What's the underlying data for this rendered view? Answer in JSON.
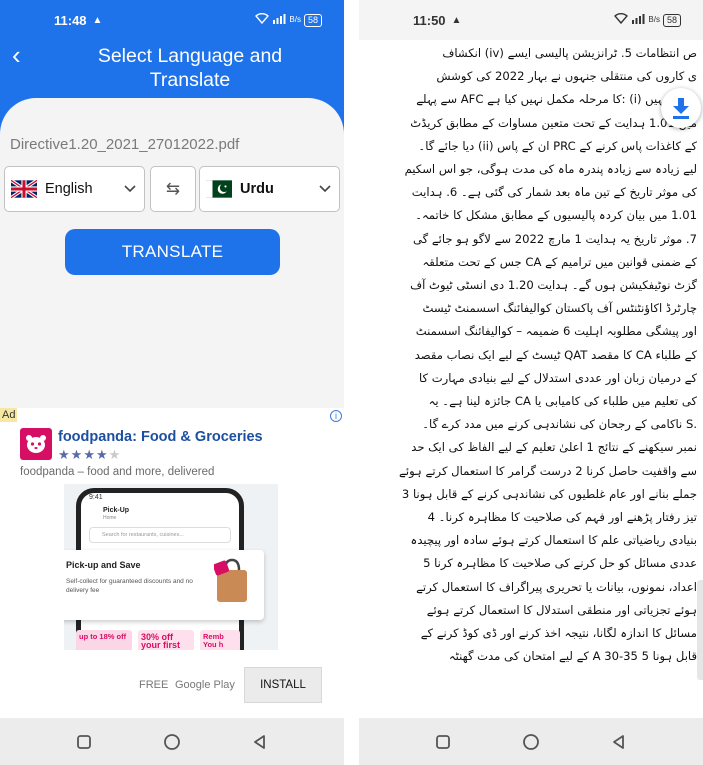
{
  "left_screen": {
    "status": {
      "time": "11:48",
      "signal_label": "B/s",
      "battery": "58"
    },
    "header": {
      "title": "Select Language and Translate"
    },
    "file_name": "Directive1.20_2021_27012022.pdf",
    "source_language": {
      "label": "English",
      "flag_icon": "uk-flag-icon"
    },
    "target_language": {
      "label": "Urdu",
      "flag_icon": "pakistan-flag-icon"
    },
    "translate_label": "TRANSLATE",
    "ad": {
      "badge": "Ad",
      "info_glyph": "i",
      "title": "foodpanda: Food & Groceries",
      "rating": 4,
      "description": "foodpanda – food and more, delivered",
      "mockup": {
        "time": "9:41",
        "screen_title": "Pick-Up",
        "screen_subtitle": "Home",
        "search_placeholder": "Search for restaurants, cuisines...",
        "card_title": "Pick-up and Save",
        "card_desc": "Self-collect for guaranteed discounts and no delivery fee",
        "promos": [
          "up to 18% off",
          "30% off your first",
          "Remb You h"
        ]
      },
      "price": "FREE",
      "store": "Google Play",
      "install_label": "INSTALL"
    }
  },
  "right_screen": {
    "status": {
      "time": "11:50",
      "signal_label": "B/s",
      "battery": "58"
    },
    "document_lines": [
      "ص انتظامات 5. ٹرانزیشن پالیسی ایسے (iv) انکشاف",
      "ی کاروں کی منتقلی جنہوں نے بہار 2022 کی کوشش",
      "PRC انہیں (i) :کا مرحلہ مکمل نہیں کیا ہے AFC سے پہلے",
      "میں 1.01 ہدایت کے تحت متعین مساوات کے مطابق کریڈٹ",
      "کے کاغذات پاس کرنے کے PRC ان کے پاس (ii) دیا جائے گا۔",
      "لیے زیادہ سے زیادہ پندرہ ماہ کی مدت ہوگی، جو اس اسکیم",
      "کی موثر تاریخ کے تین ماہ بعد شمار کی گئی ہے۔ 6. ہدایت",
      "1.01 میں بیان کردہ پالیسیوں کے مطابق مشکل کا خاتمہ۔",
      "7. موثر تاریخ یہ ہدایت 1 مارچ 2022 سے لاگو ہو جائے گی",
      "کے ضمنی قوانین میں ترامیم کے CA جس کے تحت متعلقہ",
      "گزٹ نوٹیفکیشن ہوں گے۔ ہدایت 1.20 دی انسٹی ٹیوٹ آف",
      "چارٹرڈ اکاؤنٹنٹس آف پاکستان کوالیفائنگ اسسمنٹ ٹیسٹ",
      "اور پیشگی مطلوبہ اہلیت 6 ضمیمہ – کوالیفائنگ اسسمنٹ",
      "کے طلباء CA کا مقصد QAT ٹیسٹ کے لیے ایک نصاب مقصد",
      "کے درمیان زبان اور عددی استدلال کے لیے بنیادی مہارت کا",
      "کی تعلیم میں طلباء کی کامیابی یا CA جائزہ لینا ہے۔ یہ",
      ".S ناکامی کے رجحان کی نشاندہی کرنے میں مدد کرے گا۔",
      "نمبر سیکھنے کے نتائج 1 اعلیٰ تعلیم کے لیے الفاظ کی ایک حد",
      "سے واقفیت حاصل کرنا 2 درست گرامر کا استعمال کرتے ہوئے",
      "جملے بنانے اور عام غلطیوں کی نشاندہی کرنے کے قابل ہونا 3",
      "تیز رفتار پڑھنے اور فہم کی صلاحیت کا مظاہرہ کرنا۔ 4",
      "بنیادی ریاضیاتی علم کا استعمال کرتے ہوئے سادہ اور پیچیدہ",
      "عددی مسائل کو حل کرنے کی صلاحیت کا مظاہرہ کرنا 5",
      "اعداد، نمونوں، بیانات یا تحریری پیراگراف کا استعمال کرتے",
      "ہوئے تجزیاتی اور منطقی استدلال کا استعمال کرتے ہوئے",
      "مسائل کا اندازہ لگانا، نتیجہ اخذ کرنے اور ڈی کوڈ کرنے کے",
      "قابل ہونا 5 35-30 A کے لیے امتحان کی مدت گھنٹہ"
    ]
  },
  "colors": {
    "primary_blue": "#1e73ea",
    "ad_title": "#1d4fa1",
    "foodpanda_pink": "#d70f64"
  },
  "icons": {
    "back": "back-arrow-icon",
    "swap": "swap-arrows-icon",
    "chevron": "chevron-down-icon",
    "download": "download-icon",
    "nav_recent": "square-icon",
    "nav_home": "circle-icon",
    "nav_back": "triangle-back-icon"
  }
}
